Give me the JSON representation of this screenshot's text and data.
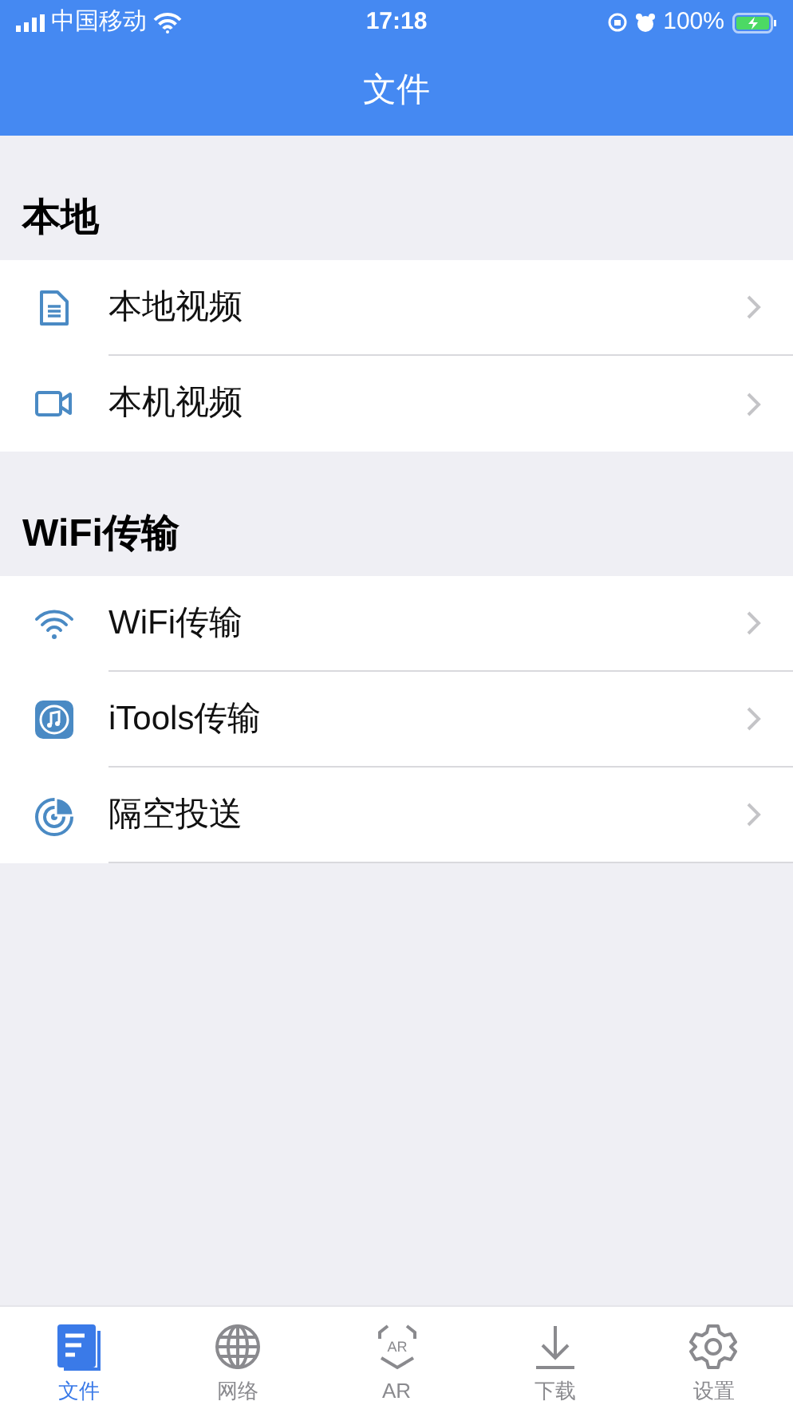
{
  "status_bar": {
    "carrier": "中国移动",
    "time": "17:18",
    "battery": "100%"
  },
  "nav_bar": {
    "title": "文件"
  },
  "sections": [
    {
      "title": "本地",
      "items": [
        {
          "kind": "document",
          "label": "本地视频"
        },
        {
          "kind": "camera",
          "label": "本机视频"
        }
      ]
    },
    {
      "title": "WiFi传输",
      "items": [
        {
          "kind": "wifi",
          "label": "WiFi传输"
        },
        {
          "kind": "music",
          "label": "iTools传输"
        },
        {
          "kind": "radar",
          "label": "隔空投送"
        }
      ]
    }
  ],
  "tab_bar": [
    {
      "kind": "files",
      "label": "文件",
      "selected": true
    },
    {
      "kind": "globe",
      "label": "网络",
      "selected": false
    },
    {
      "kind": "ar",
      "label": "AR",
      "icon_text": "AR",
      "selected": false
    },
    {
      "kind": "download",
      "label": "下载",
      "selected": false
    },
    {
      "kind": "settings",
      "label": "设置",
      "selected": false
    }
  ]
}
